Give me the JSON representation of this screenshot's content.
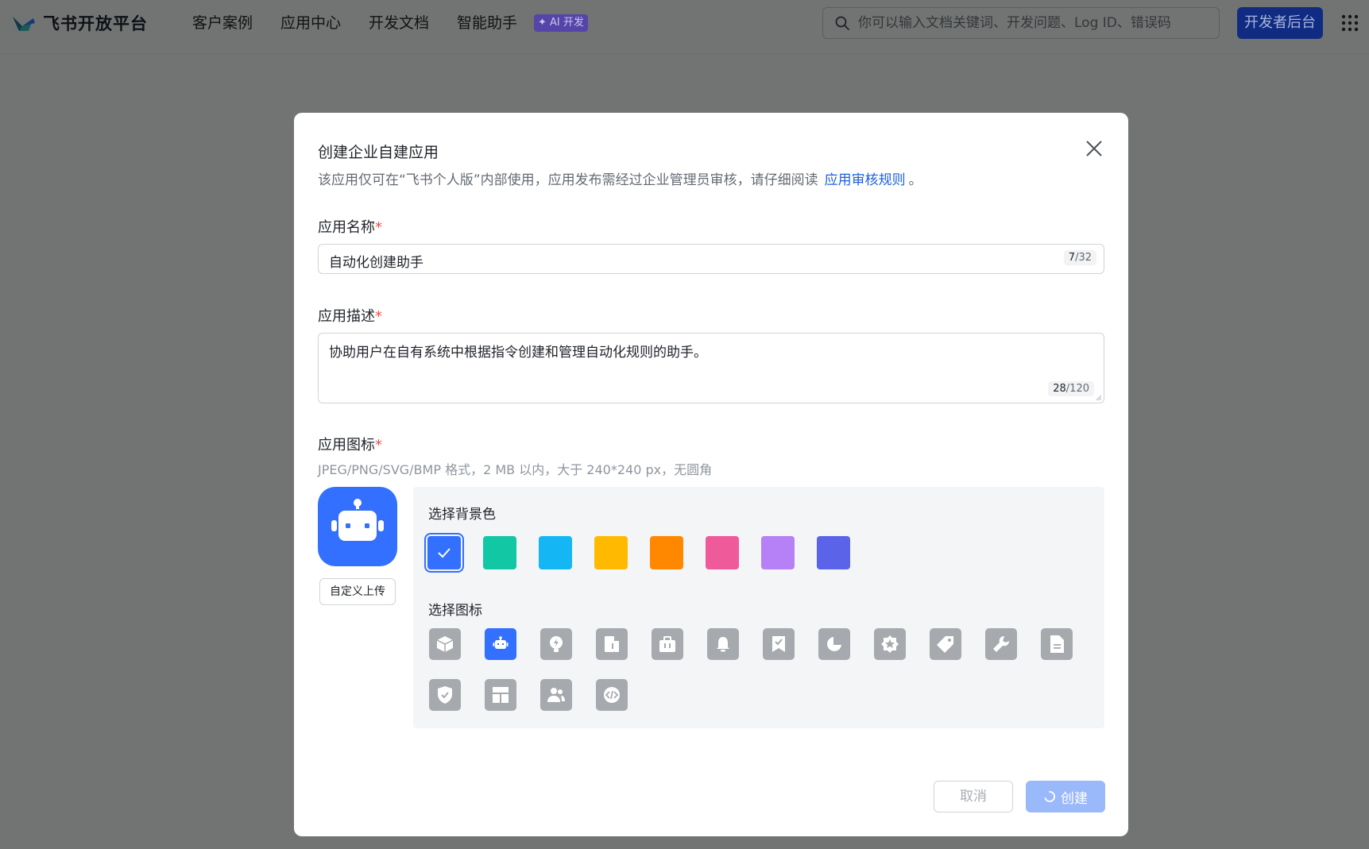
{
  "topbar": {
    "brand": "飞书开放平台",
    "nav": [
      "客户案例",
      "应用中心",
      "开发文档",
      "智能助手"
    ],
    "ai_tag": "✦ AI 开发",
    "search_placeholder": "你可以输入文档关键词、开发问题、Log ID、错误码",
    "dev_console": "开发者后台"
  },
  "modal": {
    "title": "创建企业自建应用",
    "subtitle": "该应用仅可在“飞书个人版”内部使用，应用发布需经过企业管理员审核，请仔细阅读",
    "subtitle_link": "应用审核规则",
    "subtitle_end": "。",
    "name_label": "应用名称",
    "name_value": "自动化创建助手",
    "name_count": "7",
    "name_max": "/32",
    "desc_label": "应用描述",
    "desc_value": "协助用户在自有系统中根据指令创建和管理自动化规则的助手。",
    "desc_count": "28",
    "desc_max": "/120",
    "icon_label": "应用图标",
    "icon_hint": "JPEG/PNG/SVG/BMP 格式，2 MB 以内，大于 240*240 px，无圆角",
    "required_mark": "*",
    "upload_label": "自定义上传",
    "bg_label": "选择背景色",
    "icon_pick_label": "选择图标",
    "cancel": "取消",
    "create": "创建"
  },
  "colors": {
    "selected_bg": "#3370ff",
    "swatches": [
      "#3370ff",
      "#12c7a3",
      "#14b7f4",
      "#ffba00",
      "#ff8800",
      "#ee5a9a",
      "#b680f6",
      "#5b64e9"
    ],
    "link": "#1b5fe0",
    "create_disabled": "#9ab9fa"
  },
  "icon_options": [
    "cube-icon",
    "robot-icon",
    "bulb-icon",
    "building-icon",
    "briefcase-icon",
    "bell-icon",
    "bookmark-check-icon",
    "pie-chart-icon",
    "star-badge-icon",
    "tag-icon",
    "wrench-icon",
    "document-icon",
    "shield-check-icon",
    "layout-icon",
    "people-icon",
    "code-icon"
  ],
  "selected_icon": "robot-icon",
  "selected_swatch": 0
}
